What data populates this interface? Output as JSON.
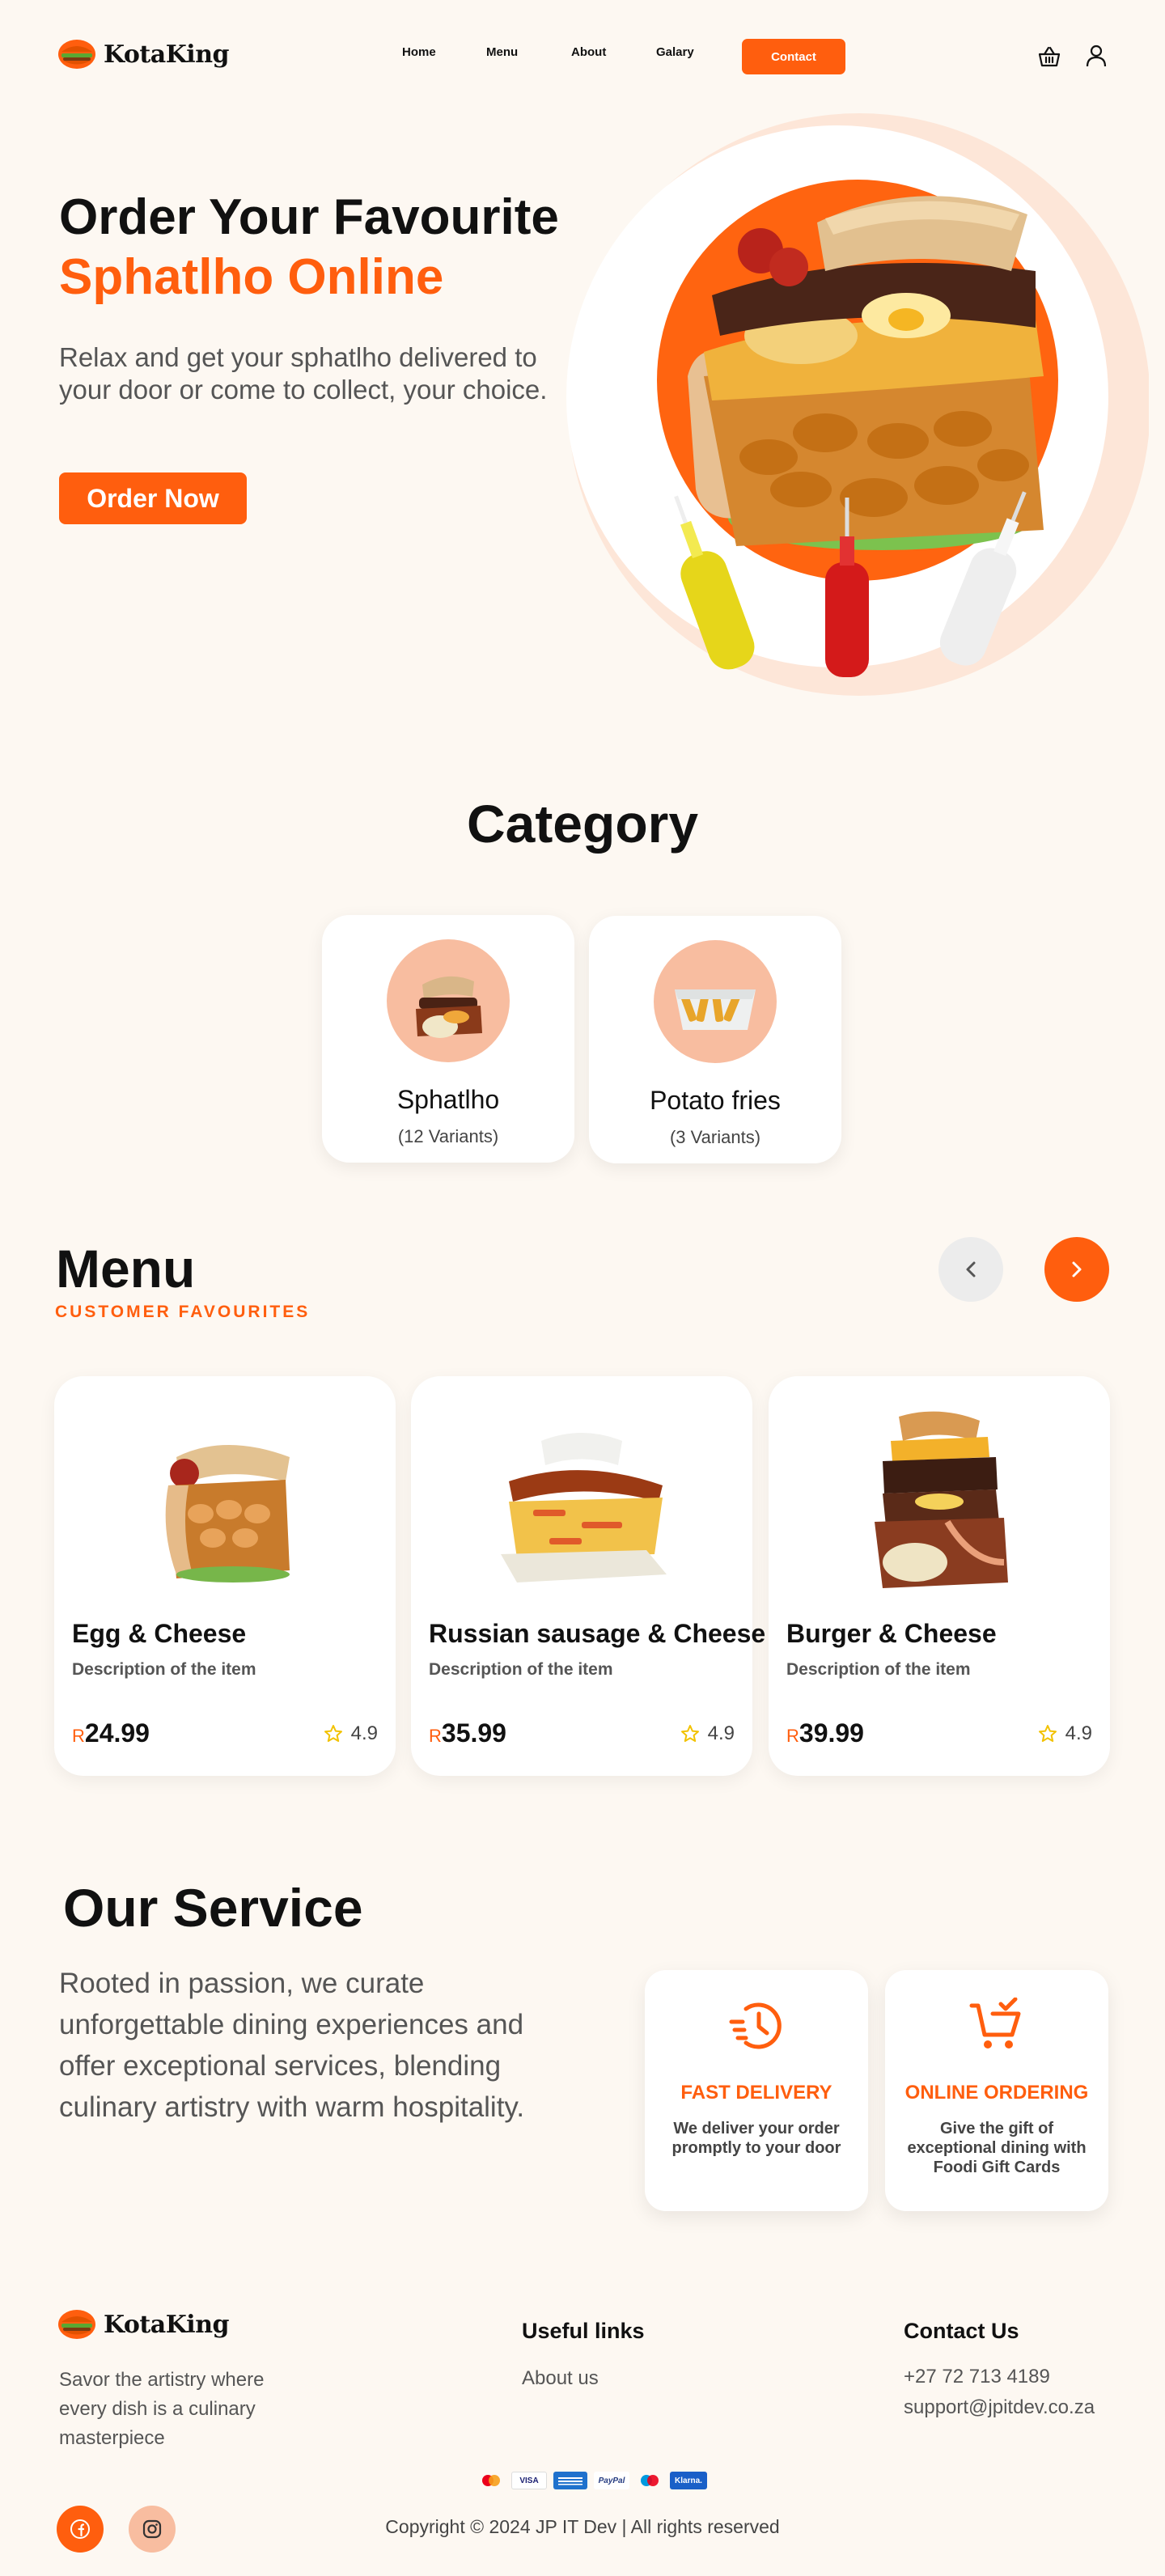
{
  "brand": {
    "name": "KotaKing"
  },
  "nav": {
    "links": [
      "Home",
      "Menu",
      "About",
      "Galary"
    ],
    "contact_label": "Contact",
    "cart_icon": "basket-icon",
    "user_icon": "user-icon"
  },
  "hero": {
    "title_line1": "Order Your Favourite",
    "title_line2": "Sphatlho Online",
    "subtitle": "Relax and get your sphatlho delivered to your door or come to collect, your choice.",
    "button_label": "Order Now"
  },
  "category": {
    "title": "Category",
    "items": [
      {
        "name": "Sphatlho",
        "count": "(12 Variants)"
      },
      {
        "name": "Potato fries",
        "count": "(3 Variants)"
      }
    ]
  },
  "menu": {
    "title": "Menu",
    "subtitle": "CUSTOMER FAVOURITES",
    "items": [
      {
        "name": "Egg & Cheese",
        "description": "Description of the item",
        "currency": "R",
        "price": "24.99",
        "rating": "4.9"
      },
      {
        "name": "Russian sausage & Cheese",
        "description": "Description of the item",
        "currency": "R",
        "price": "35.99",
        "rating": "4.9"
      },
      {
        "name": "Burger & Cheese",
        "description": "Description of the item",
        "currency": "R",
        "price": "39.99",
        "rating": "4.9"
      }
    ]
  },
  "service": {
    "title": "Our Service",
    "text": "Rooted in passion, we curate unforgettable dining experiences and offer exceptional services, blending culinary artistry with warm hospitality.",
    "cards": [
      {
        "title": "FAST DELIVERY",
        "description": "We deliver your order promptly to your door"
      },
      {
        "title": "ONLINE ORDERING",
        "description": "Give the gift of exceptional dining with Foodi Gift Cards"
      }
    ]
  },
  "footer": {
    "tagline": "Savor the artistry where every dish is a culinary masterpiece",
    "useful_title": "Useful links",
    "useful_links": [
      "About us"
    ],
    "contact_title": "Contact Us",
    "phone": "+27 72 713 4189",
    "email": "support@jpitdev.co.za",
    "payments": [
      "VISA",
      "PayPal",
      "Klarna."
    ],
    "copyright": "Copyright  ©  2024 JP IT Dev | All rights reserved"
  },
  "colors": {
    "accent": "#ff5e0e",
    "background": "#fdf8f2",
    "peach": "#f8bda0"
  }
}
